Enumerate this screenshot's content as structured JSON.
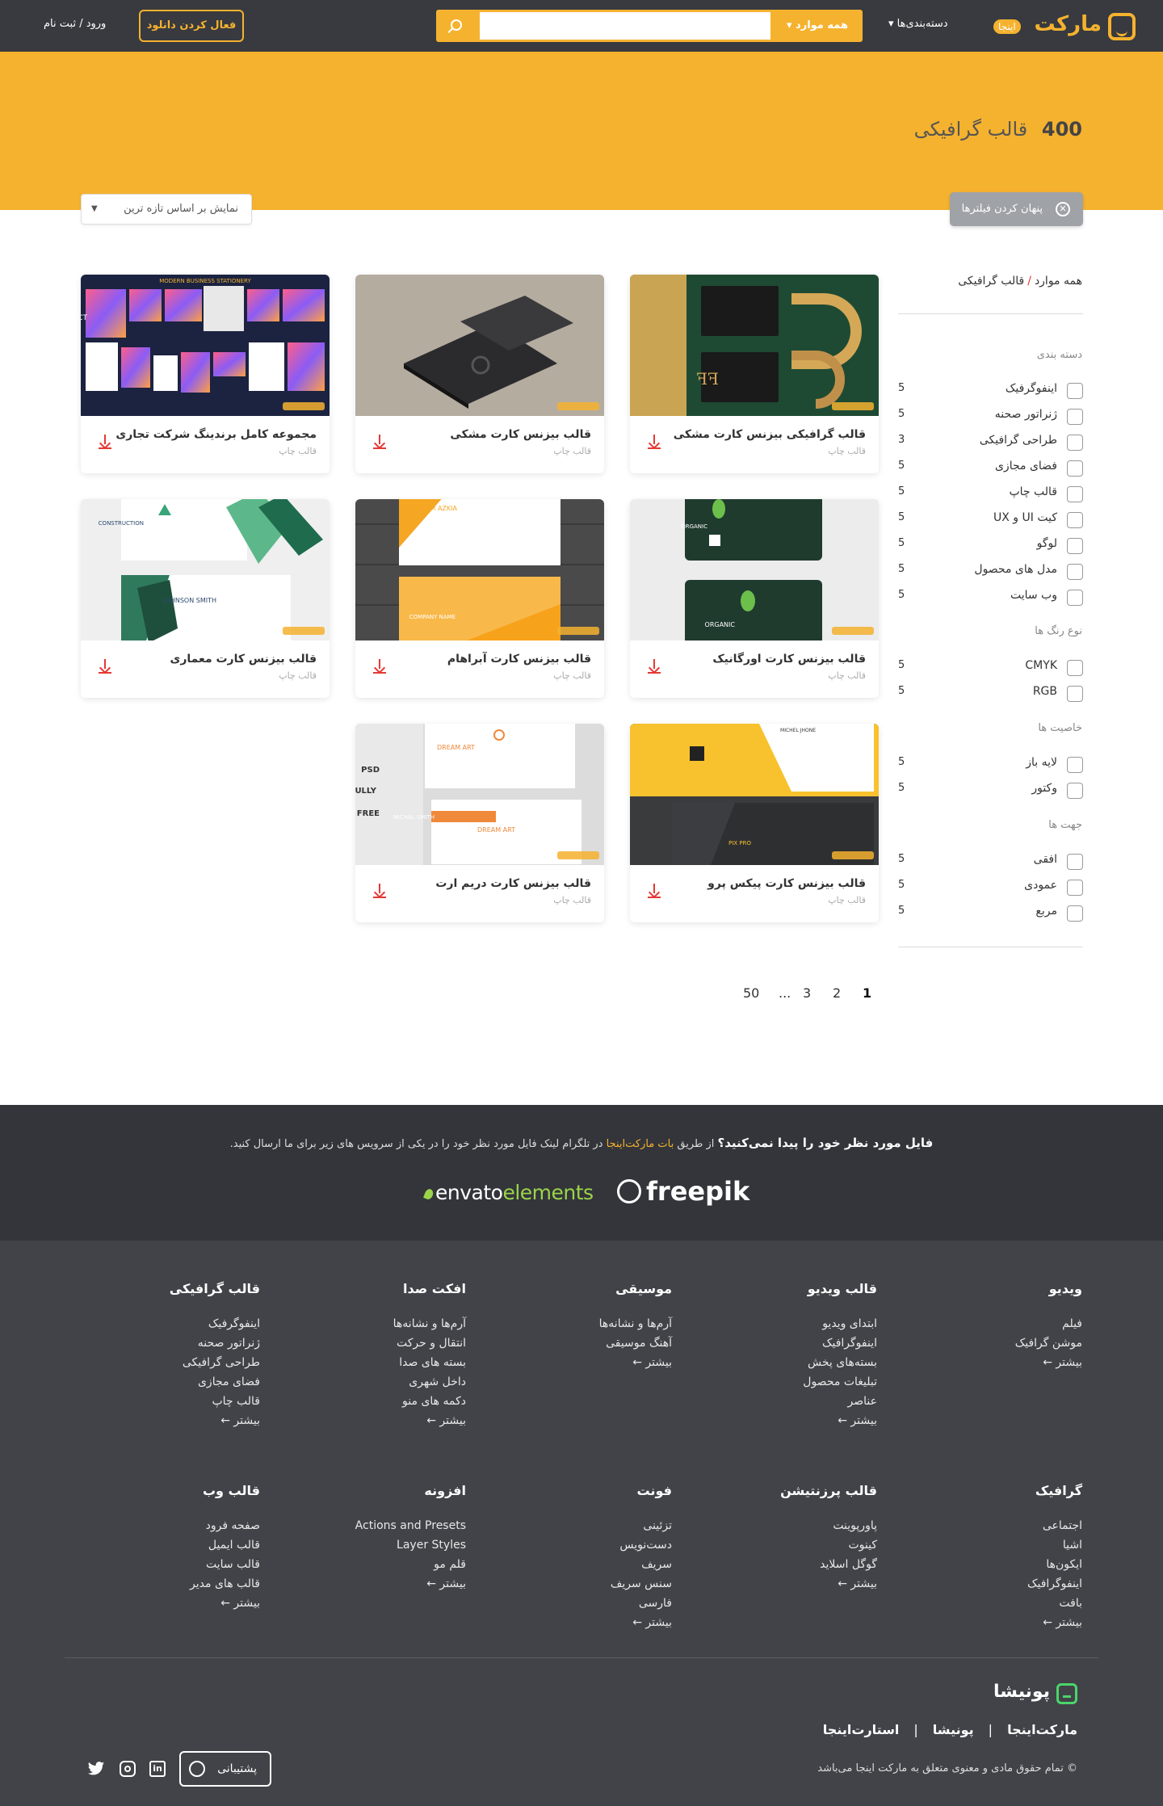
{
  "header": {
    "logo_text": "مارکت",
    "logo_tag": "اینجا",
    "categories_label": "دسته‌بندی‌ها ▾",
    "search_category": "همه موارد ▾",
    "search_placeholder": "",
    "activate_download": "فعال کردن دانلود",
    "login": "ورود / ثبت نام"
  },
  "hero": {
    "count": "400",
    "title": "قالب گرافیکی",
    "hide_filters": "پنهان کردن فیلترها",
    "sort": "نمایش بر اساس تازه ترین"
  },
  "breadcrumb": {
    "root": "همه موارد",
    "sep": "/",
    "current": "قالب گرافیکی"
  },
  "filters": {
    "category": {
      "title": "دسته بندی",
      "items": [
        {
          "label": "اینفوگرفیک",
          "count": "5"
        },
        {
          "label": "ژنراتور صحنه",
          "count": "5"
        },
        {
          "label": "طراحی گرافیکی",
          "count": "3"
        },
        {
          "label": "فضای مجازی",
          "count": "5"
        },
        {
          "label": "قالب چاپ",
          "count": "5"
        },
        {
          "label": "کیت UI و UX",
          "count": "5"
        },
        {
          "label": "لوگو",
          "count": "5"
        },
        {
          "label": "مدل های محصول",
          "count": "5"
        },
        {
          "label": "وب سایت",
          "count": "5"
        }
      ]
    },
    "color": {
      "title": "نوع رنگ ها",
      "items": [
        {
          "label": "CMYK",
          "count": "5"
        },
        {
          "label": "RGB",
          "count": "5"
        }
      ]
    },
    "feature": {
      "title": "خاصیت ها",
      "items": [
        {
          "label": "لایه باز",
          "count": "5"
        },
        {
          "label": "وکتور",
          "count": "5"
        }
      ]
    },
    "orientation": {
      "title": "جهت ها",
      "items": [
        {
          "label": "افقی",
          "count": "5"
        },
        {
          "label": "عمودی",
          "count": "5"
        },
        {
          "label": "مربع",
          "count": "5"
        }
      ]
    }
  },
  "cards": [
    {
      "title": "قالب گرافیکی بیزنس کارت مشکی",
      "category": "قالب چاپ"
    },
    {
      "title": "قالب بیزنس کارت مشکی",
      "category": "قالب چاپ"
    },
    {
      "title": "مجموعه کامل برندینگ شرکت تجاری",
      "category": "قالب چاپ"
    },
    {
      "title": "قالب بیزنس کارت اورگانیک",
      "category": "قالب چاپ"
    },
    {
      "title": "قالب بیزنس کارت آبراهام",
      "category": "قالب چاپ"
    },
    {
      "title": "قالب بیزنس کارت معماری",
      "category": "قالب چاپ"
    },
    {
      "title": "قالب بیزنس کارت پیکس پرو",
      "category": "قالب چاپ"
    },
    {
      "title": "قالب بیزنس کارت دریم ارت",
      "category": "قالب چاپ"
    }
  ],
  "thumb_text": {
    "modern": "MODERN BUSINESS STATIONERY",
    "abstract": "BSTRACT",
    "construction": "CONSTRUCTION",
    "johnson": "JOHNSON SMITH",
    "organic": "ORGANIC",
    "abraham": "ABRAHAM AZKIA",
    "company": "COMPANY NAME",
    "michel": "MICHEL JHONE",
    "pixpro": "PIX PRO",
    "dreamart": "DREAM ART",
    "psd": "PSD",
    "fully": "FULLY",
    "free": "FREE",
    "michal": "MICHAL SMITH"
  },
  "pagination": [
    "1",
    "2",
    "3",
    "...",
    "50"
  ],
  "request": {
    "question": "فایل مورد نظر خود را پیدا نمی‌کنید؟",
    "pre": "از طریق",
    "bot": "بات مارکت‌اینجا",
    "post": "در تلگرام لینک فایل مورد نظر خود را در یکی از سرویس های زیر برای ما ارسال کنید.",
    "envato_a": "envato",
    "envato_b": "elements",
    "freepik": "freepik"
  },
  "footer": {
    "columns": [
      {
        "title": "ویدیو",
        "links": [
          "فیلم",
          "موشن گرافیک",
          "بیشتر ←"
        ]
      },
      {
        "title": "قالب ویدیو",
        "links": [
          "ابتدای ویدیو",
          "اینفوگرافیک",
          "بسته‌های پخش",
          "تبلیغات محصول",
          "عناصر",
          "بیشتر ←"
        ]
      },
      {
        "title": "موسیقی",
        "links": [
          "آرم‌ها و نشانه‌ها",
          "آهنگ موسیقی",
          "بیشتر ←"
        ]
      },
      {
        "title": "افکت صدا",
        "links": [
          "آرم‌ها و نشانه‌ها",
          "انتقال و حرکت",
          "بسته های صدا",
          "داخل شهری",
          "دکمه های منو",
          "بیشتر ←"
        ]
      },
      {
        "title": "قالب گرافیکی",
        "links": [
          "اینفوگرفیک",
          "ژنراتور صحنه",
          "طراحی گرافیکی",
          "فضای مجازی",
          "قالب چاپ",
          "بیشتر ←"
        ]
      },
      {
        "title": "گرافیک",
        "links": [
          "اجتماعی",
          "اشیا",
          "ایکون‌ها",
          "اینفوگرافیک",
          "بافت",
          "بیشتر ←"
        ]
      },
      {
        "title": "قالب پرزنتیشن",
        "links": [
          "پاورپوینت",
          "کینوت",
          "گوگل اسلاید",
          "بیشتر ←"
        ]
      },
      {
        "title": "فونت",
        "links": [
          "تزئینی",
          "دست‌نویس",
          "سریف",
          "سنس سریف",
          "فارسی",
          "بیشتر ←"
        ]
      },
      {
        "title": "افزونه",
        "links": [
          "Actions and Presets",
          "Layer Styles",
          "قلم مو",
          "بیشتر ←"
        ]
      },
      {
        "title": "قالب وب",
        "links": [
          "صفحه فرود",
          "قالب ایمیل",
          "قالب سایت",
          "قالب های مدیر",
          "بیشتر ←"
        ]
      }
    ],
    "brand": "پونیشا",
    "links": [
      "مارکت‌اینجا",
      "پونیشا",
      "استارت‌اینجا"
    ],
    "sep": "|",
    "copyright": "© تمام حقوق مادی و معنوی متعلق به مارکت اینجا می‌باشد",
    "support": "پشتیبانی",
    "linkedin": "in"
  }
}
